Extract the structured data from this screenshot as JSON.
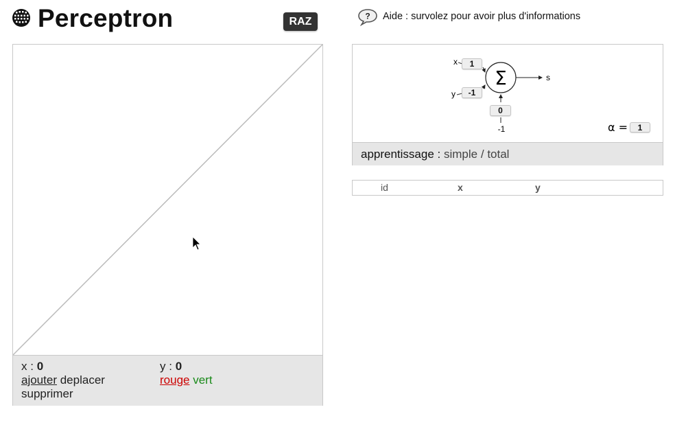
{
  "header": {
    "title": "Perceptron",
    "reset_label": "RAZ",
    "help_text": "Aide : survolez pour avoir plus d'informations",
    "help_icon_glyph": "?"
  },
  "canvas": {
    "footer": {
      "x_label": "x :",
      "x_value": "0",
      "y_label": "y :",
      "y_value": "0",
      "mode_add": "ajouter",
      "mode_move": "deplacer",
      "mode_delete": "supprimer",
      "color_red": "rouge",
      "color_green": "vert"
    },
    "colors": {
      "red": "#cc0000",
      "green": "#1a8a1a",
      "line": "#bbbbbb"
    }
  },
  "neuron": {
    "input_x_label": "x",
    "input_y_label": "y",
    "weight_x": "1",
    "weight_y": "-1",
    "bias_weight": "0",
    "bias_input": "-1",
    "sum_symbol": "Σ",
    "output_label": "s",
    "alpha_label": "α =",
    "alpha_value": "1"
  },
  "learning": {
    "label": "apprentissage :",
    "simple": "simple",
    "separator": "/",
    "total": "total"
  },
  "table": {
    "headers": [
      "id",
      "x",
      "y"
    ]
  }
}
